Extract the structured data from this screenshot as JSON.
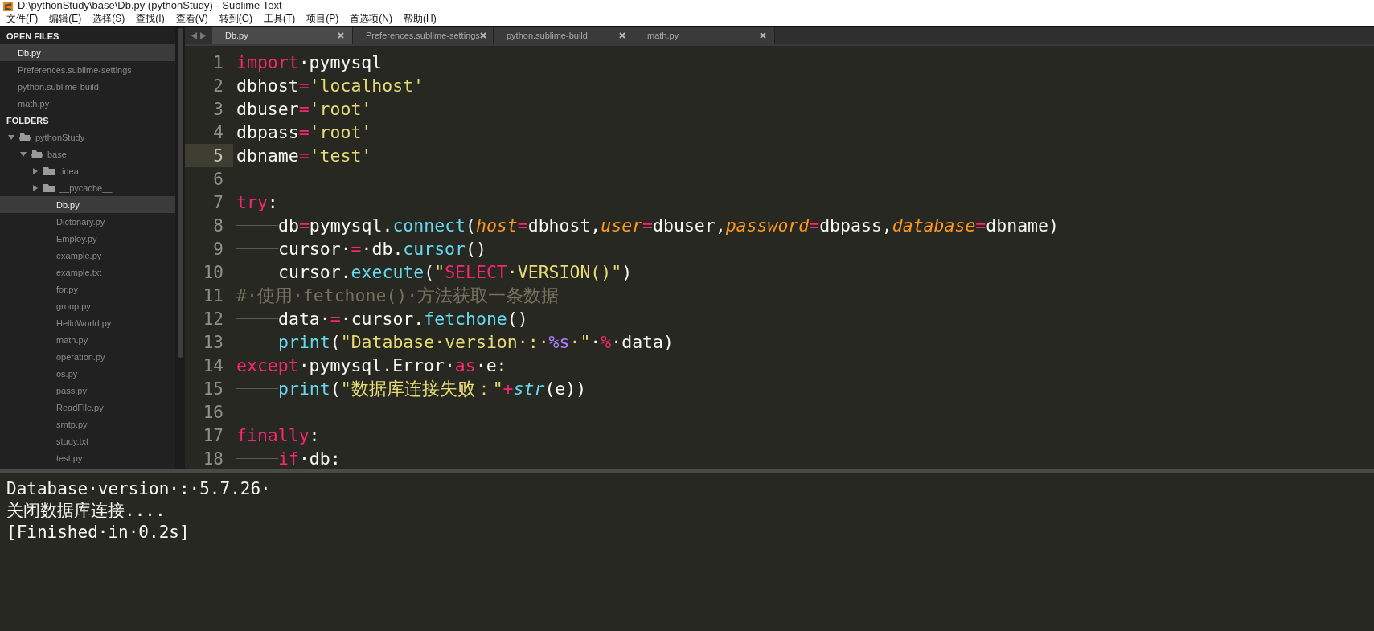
{
  "window": {
    "title": "D:\\pythonStudy\\base\\Db.py (pythonStudy) - Sublime Text"
  },
  "menu": [
    "文件(F)",
    "编辑(E)",
    "选择(S)",
    "查找(I)",
    "查看(V)",
    "转到(G)",
    "工具(T)",
    "项目(P)",
    "首选项(N)",
    "帮助(H)"
  ],
  "sidebar": {
    "open_files_header": "OPEN FILES",
    "open_files": [
      {
        "label": "Db.py",
        "selected": true
      },
      {
        "label": "Preferences.sublime-settings",
        "selected": false
      },
      {
        "label": "python.sublime-build",
        "selected": false
      },
      {
        "label": "math.py",
        "selected": false
      }
    ],
    "folders_header": "FOLDERS",
    "tree": [
      {
        "label": "pythonStudy",
        "kind": "folder",
        "expanded": true,
        "children": [
          {
            "label": "base",
            "kind": "folder",
            "expanded": true,
            "children": [
              {
                "label": ".idea",
                "kind": "folder",
                "expanded": false
              },
              {
                "label": "__pycache__",
                "kind": "folder",
                "expanded": false
              },
              {
                "label": "Db.py",
                "kind": "file",
                "selected": true
              },
              {
                "label": "Dictonary.py",
                "kind": "file",
                "selected": false
              },
              {
                "label": "Employ.py",
                "kind": "file",
                "selected": false
              },
              {
                "label": "example.py",
                "kind": "file",
                "selected": false
              },
              {
                "label": "example.txt",
                "kind": "file",
                "selected": false
              },
              {
                "label": "for.py",
                "kind": "file",
                "selected": false
              },
              {
                "label": "group.py",
                "kind": "file",
                "selected": false
              },
              {
                "label": "HelloWorld.py",
                "kind": "file",
                "selected": false
              },
              {
                "label": "math.py",
                "kind": "file",
                "selected": false
              },
              {
                "label": "operation.py",
                "kind": "file",
                "selected": false
              },
              {
                "label": "os.py",
                "kind": "file",
                "selected": false
              },
              {
                "label": "pass.py",
                "kind": "file",
                "selected": false
              },
              {
                "label": "ReadFile.py",
                "kind": "file",
                "selected": false
              },
              {
                "label": "smtp.py",
                "kind": "file",
                "selected": false
              },
              {
                "label": "study.txt",
                "kind": "file",
                "selected": false
              },
              {
                "label": "test.py",
                "kind": "file",
                "selected": false
              }
            ]
          }
        ]
      }
    ]
  },
  "tabs": [
    {
      "label": "Db.py",
      "selected": true
    },
    {
      "label": "Preferences.sublime-settings",
      "selected": false
    },
    {
      "label": "python.sublime-build",
      "selected": false
    },
    {
      "label": "math.py",
      "selected": false
    }
  ],
  "editor": {
    "lines": [
      {
        "number": "1",
        "current": false,
        "tokens": [
          {
            "kind": "keyword",
            "text": "import"
          },
          {
            "kind": "plain",
            "text": "·pymysql"
          }
        ]
      },
      {
        "number": "2",
        "current": false,
        "tokens": [
          {
            "kind": "plain",
            "text": "dbhost"
          },
          {
            "kind": "keyword",
            "text": "="
          },
          {
            "kind": "string",
            "text": "'localhost'"
          }
        ]
      },
      {
        "number": "3",
        "current": false,
        "tokens": [
          {
            "kind": "plain",
            "text": "dbuser"
          },
          {
            "kind": "keyword",
            "text": "="
          },
          {
            "kind": "string",
            "text": "'root'"
          }
        ]
      },
      {
        "number": "4",
        "current": false,
        "tokens": [
          {
            "kind": "plain",
            "text": "dbpass"
          },
          {
            "kind": "keyword",
            "text": "="
          },
          {
            "kind": "string",
            "text": "'root'"
          }
        ]
      },
      {
        "number": "5",
        "current": true,
        "tokens": [
          {
            "kind": "plain",
            "text": "dbname"
          },
          {
            "kind": "keyword",
            "text": "="
          },
          {
            "kind": "string",
            "text": "'test'"
          }
        ]
      },
      {
        "number": "6",
        "current": false
      },
      {
        "number": "7",
        "current": false,
        "tokens": [
          {
            "kind": "keyword",
            "text": "try"
          },
          {
            "kind": "plain",
            "text": ":"
          }
        ]
      },
      {
        "number": "8",
        "current": false,
        "indent": true,
        "tokens": [
          {
            "kind": "plain",
            "text": "db"
          },
          {
            "kind": "keyword",
            "text": "="
          },
          {
            "kind": "plain",
            "text": "pymysql."
          },
          {
            "kind": "function",
            "text": "connect"
          },
          {
            "kind": "plain",
            "text": "("
          },
          {
            "kind": "param",
            "text": "host"
          },
          {
            "kind": "keyword",
            "text": "="
          },
          {
            "kind": "plain",
            "text": "dbhost,"
          },
          {
            "kind": "param",
            "text": "user"
          },
          {
            "kind": "keyword",
            "text": "="
          },
          {
            "kind": "plain",
            "text": "dbuser,"
          },
          {
            "kind": "param",
            "text": "password"
          },
          {
            "kind": "keyword",
            "text": "="
          },
          {
            "kind": "plain",
            "text": "dbpass,"
          },
          {
            "kind": "param",
            "text": "database"
          },
          {
            "kind": "keyword",
            "text": "="
          },
          {
            "kind": "plain",
            "text": "dbname)"
          }
        ]
      },
      {
        "number": "9",
        "current": false,
        "indent": true,
        "tokens": [
          {
            "kind": "plain",
            "text": "cursor·"
          },
          {
            "kind": "keyword",
            "text": "="
          },
          {
            "kind": "plain",
            "text": "·db."
          },
          {
            "kind": "function",
            "text": "cursor"
          },
          {
            "kind": "plain",
            "text": "()"
          }
        ]
      },
      {
        "number": "10",
        "current": false,
        "indent": true,
        "tokens": [
          {
            "kind": "plain",
            "text": "cursor."
          },
          {
            "kind": "function",
            "text": "execute"
          },
          {
            "kind": "plain",
            "text": "("
          },
          {
            "kind": "string",
            "text": "\""
          },
          {
            "kind": "keyword",
            "text": "SELECT"
          },
          {
            "kind": "string",
            "text": "·VERSION()\""
          },
          {
            "kind": "plain",
            "text": ")"
          }
        ]
      },
      {
        "number": "11",
        "current": false,
        "tokens": [
          {
            "kind": "comment",
            "text": "#·使用·fetchone()·方法获取一条数据"
          }
        ]
      },
      {
        "number": "12",
        "current": false,
        "indent": true,
        "tokens": [
          {
            "kind": "plain",
            "text": "data·"
          },
          {
            "kind": "keyword",
            "text": "="
          },
          {
            "kind": "plain",
            "text": "·cursor."
          },
          {
            "kind": "function",
            "text": "fetchone"
          },
          {
            "kind": "plain",
            "text": "()"
          }
        ]
      },
      {
        "number": "13",
        "current": false,
        "indent": true,
        "tokens": [
          {
            "kind": "function",
            "text": "print"
          },
          {
            "kind": "plain",
            "text": "("
          },
          {
            "kind": "string",
            "text": "\"Database·version·:·"
          },
          {
            "kind": "constant",
            "text": "%s"
          },
          {
            "kind": "string",
            "text": "·\""
          },
          {
            "kind": "plain",
            "text": "·"
          },
          {
            "kind": "keyword",
            "text": "%"
          },
          {
            "kind": "plain",
            "text": "·data)"
          }
        ]
      },
      {
        "number": "14",
        "current": false,
        "tokens": [
          {
            "kind": "keyword",
            "text": "except"
          },
          {
            "kind": "plain",
            "text": "·pymysql.Error·"
          },
          {
            "kind": "keyword",
            "text": "as"
          },
          {
            "kind": "plain",
            "text": "·e:"
          }
        ]
      },
      {
        "number": "15",
        "current": false,
        "indent": true,
        "tokens": [
          {
            "kind": "function",
            "text": "print"
          },
          {
            "kind": "plain",
            "text": "("
          },
          {
            "kind": "string",
            "text": "\"数据库连接失败：\""
          },
          {
            "kind": "keyword",
            "text": "+"
          },
          {
            "kind": "builtin",
            "text": "str"
          },
          {
            "kind": "plain",
            "text": "(e))"
          }
        ]
      },
      {
        "number": "16",
        "current": false
      },
      {
        "number": "17",
        "current": false,
        "tokens": [
          {
            "kind": "keyword",
            "text": "finally"
          },
          {
            "kind": "plain",
            "text": ":"
          }
        ]
      },
      {
        "number": "18",
        "current": false,
        "indent": true,
        "tokens": [
          {
            "kind": "keyword",
            "text": "if"
          },
          {
            "kind": "plain",
            "text": "·db:"
          }
        ]
      }
    ]
  },
  "output": {
    "lines": [
      "Database·version·:·5.7.26·",
      "关闭数据库连接....",
      "[Finished·in·0.2s]"
    ]
  }
}
